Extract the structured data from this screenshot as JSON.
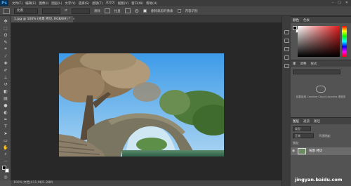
{
  "app": {
    "logo": "Ps"
  },
  "menu": [
    "文件(F)",
    "编辑(E)",
    "图像(I)",
    "图层(L)",
    "文字(Y)",
    "选择(S)",
    "滤镜(T)",
    "3D(D)",
    "视图(V)",
    "窗口(W)",
    "帮助(H)"
  ],
  "options": {
    "ratio_select": "比例",
    "swap_icon": "⇄",
    "clear_label": "清除",
    "straighten_label": "拉直",
    "delete_pixels_label": "删除裁剪的像素",
    "content_aware_label": "内容识别"
  },
  "document": {
    "tab_title": "1.jpg @ 100% (背景 拷贝, RGB/8#) *"
  },
  "status": {
    "text": "100%     文档:411.9K/1.28M"
  },
  "panels": {
    "color": {
      "tabs": [
        "颜色",
        "色板"
      ]
    },
    "libraries": {
      "tabs": [
        "库",
        "调整",
        "样式"
      ],
      "message": "若要使用 Creative Cloud Libraries 请登录"
    },
    "layers": {
      "tabs": [
        "图层",
        "通道",
        "路径"
      ],
      "kind_select": "类型",
      "blend_mode": "正常",
      "opacity_label": "不透明度:",
      "lock_label": "锁定:",
      "items": [
        {
          "name": "背景 拷贝"
        }
      ]
    }
  },
  "watermark": "jingyan.baidu.com"
}
